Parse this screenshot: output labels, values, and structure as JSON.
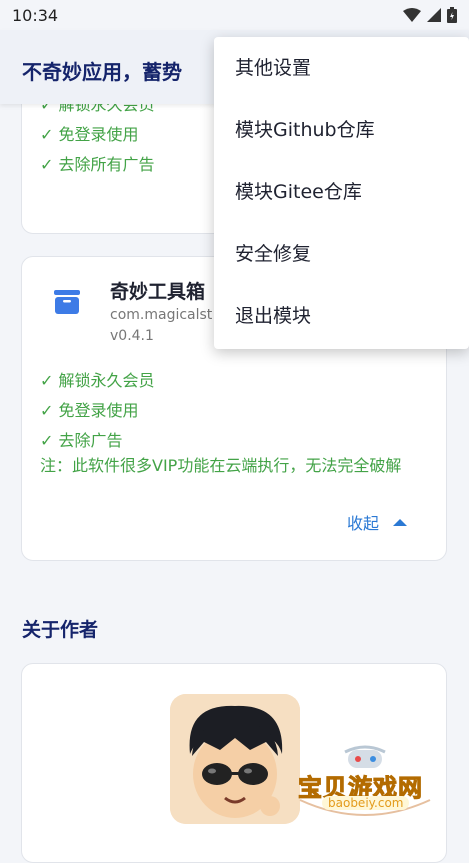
{
  "status_bar": {
    "time": "10:34"
  },
  "app_bar": {
    "title": "不奇妙应用，蓄势"
  },
  "card1": {
    "features": [
      "✓ 解锁永久会员",
      "✓ 免登录使用",
      "✓ 去除所有广告"
    ]
  },
  "card2": {
    "app_name": "奇妙工具箱",
    "package": "com.magicalst",
    "version": "v0.4.1",
    "features": [
      "✓ 解锁永久会员",
      "✓ 免登录使用",
      "✓ 去除广告"
    ],
    "note": "注：此软件很多VIP功能在云端执行，无法完全破解",
    "collapse_label": "收起"
  },
  "about": {
    "section_title": "关于作者"
  },
  "menu": {
    "items": [
      "其他设置",
      "模块Github仓库",
      "模块Gitee仓库",
      "安全修复",
      "退出模块"
    ]
  },
  "watermark": {
    "text": "宝贝游戏网",
    "url": "baobeiy.com"
  },
  "colors": {
    "accent": "#2b79d4",
    "green": "#43a347",
    "title": "#15246b"
  }
}
